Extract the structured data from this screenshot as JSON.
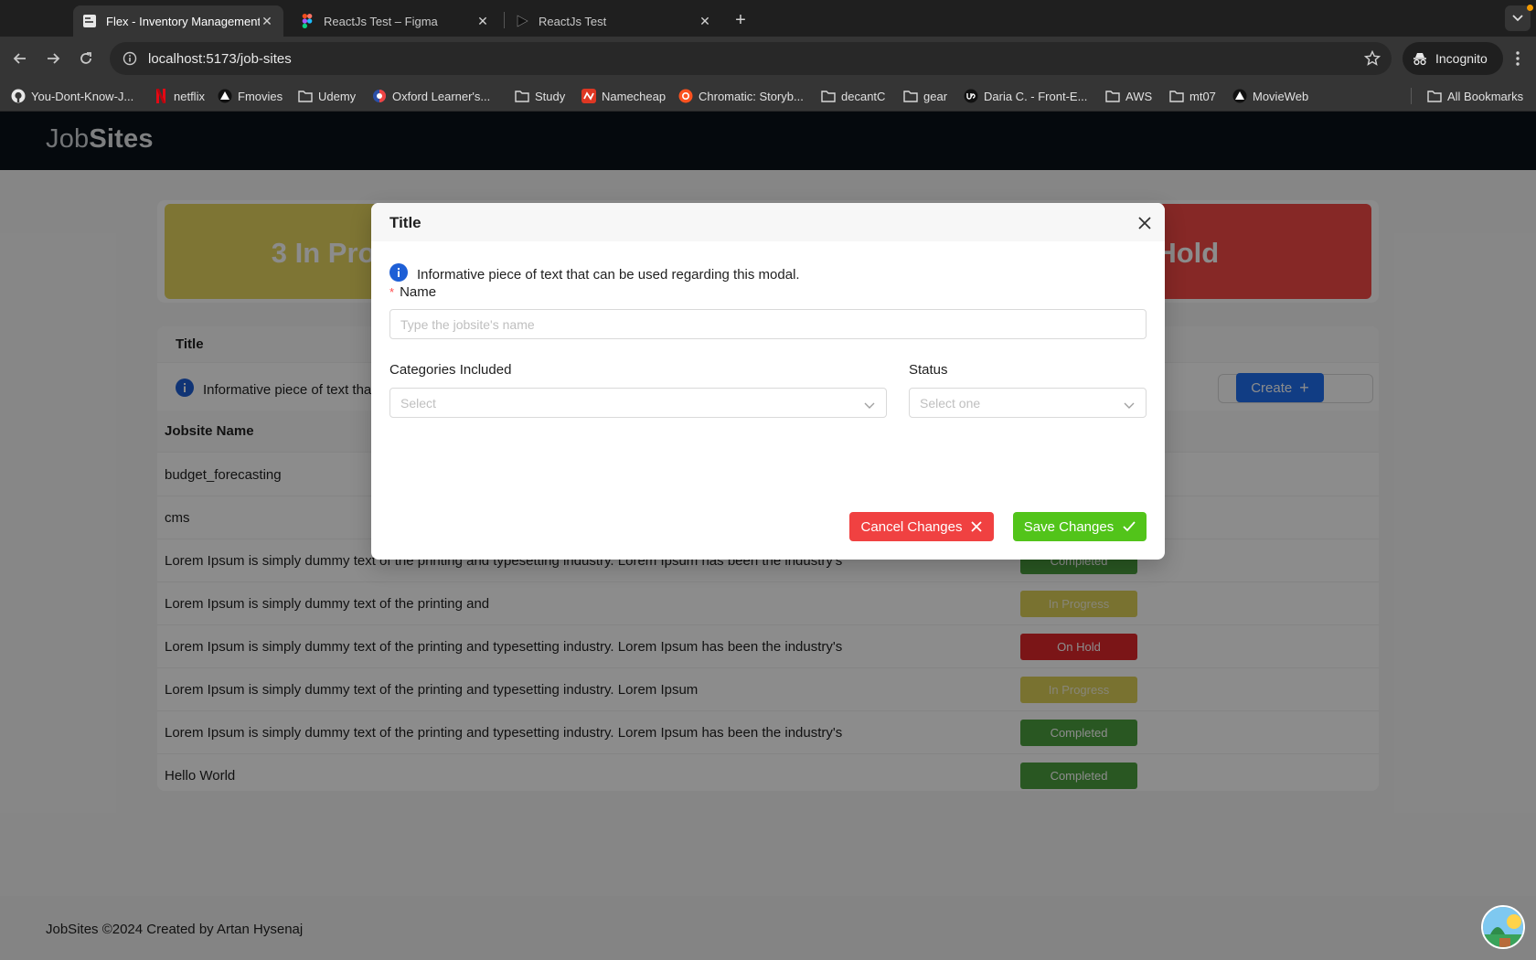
{
  "browser": {
    "tabs": [
      {
        "label": "Flex - Inventory Management",
        "active": true
      },
      {
        "label": "ReactJs Test – Figma",
        "active": false
      },
      {
        "label": "ReactJs Test",
        "active": false
      }
    ],
    "url": "localhost:5173/job-sites",
    "incognito_label": "Incognito",
    "bookmarks": [
      {
        "label": "You-Dont-Know-J...",
        "icon": "github-icon"
      },
      {
        "label": "netflix",
        "icon": "netflix-icon"
      },
      {
        "label": "Fmovies",
        "icon": "fmovies-icon"
      },
      {
        "label": "Udemy",
        "icon": "folder-icon"
      },
      {
        "label": "Oxford Learner's...",
        "icon": "oxford-icon"
      },
      {
        "label": "Study",
        "icon": "folder-icon"
      },
      {
        "label": "Namecheap",
        "icon": "namecheap-icon"
      },
      {
        "label": "Chromatic: Storyb...",
        "icon": "chromatic-icon"
      },
      {
        "label": "decantC",
        "icon": "folder-icon"
      },
      {
        "label": "gear",
        "icon": "folder-icon"
      },
      {
        "label": "Daria C. - Front-E...",
        "icon": "upwork-icon"
      },
      {
        "label": "AWS",
        "icon": "folder-icon"
      },
      {
        "label": "mt07",
        "icon": "folder-icon"
      },
      {
        "label": "MovieWeb",
        "icon": "movieweb-icon"
      }
    ],
    "all_bookmarks": "All Bookmarks"
  },
  "app": {
    "brand_light": "Job",
    "brand_bold": "Sites",
    "stats": {
      "in_progress": "3 In Progress",
      "on_hold": "n Hold"
    },
    "table": {
      "title": "Title",
      "info": "Informative piece of text that can be used regarding this modal.",
      "create_label": "Create",
      "column_name": "Jobsite Name",
      "rows": [
        {
          "name": "budget_forecasting",
          "status": ""
        },
        {
          "name": "cms",
          "status": ""
        },
        {
          "name": "Lorem Ipsum is simply dummy text of the printing and typesetting industry. Lorem Ipsum has been the industry's",
          "status": "Completed"
        },
        {
          "name": "Lorem Ipsum is simply dummy text of the printing and",
          "status": "In Progress"
        },
        {
          "name": "Lorem Ipsum is simply dummy text of the printing and typesetting industry. Lorem Ipsum has been the industry's",
          "status": "On Hold"
        },
        {
          "name": "Lorem Ipsum is simply dummy text of the printing and typesetting industry. Lorem Ipsum",
          "status": "In Progress"
        },
        {
          "name": "Lorem Ipsum is simply dummy text of the printing and typesetting industry. Lorem Ipsum has been the industry's",
          "status": "Completed"
        },
        {
          "name": "Hello World",
          "status": "Completed"
        }
      ]
    },
    "footer": "JobSites ©2024 Created by Artan Hysenaj"
  },
  "modal": {
    "title": "Title",
    "info": "Informative piece of text that can be used regarding this modal.",
    "name_label": "Name",
    "name_placeholder": "Type the jobsite's name",
    "categories_label": "Categories Included",
    "categories_placeholder": "Select",
    "status_label": "Status",
    "status_placeholder": "Select one",
    "cancel_label": "Cancel Changes",
    "save_label": "Save Changes"
  },
  "colors": {
    "header_bg": "#0a1119",
    "in_progress": "#dccf58",
    "on_hold": "#e0272b",
    "completed": "#4c9e3e",
    "primary": "#1f6ff0",
    "cancel": "#f04141",
    "save": "#52c41a"
  }
}
